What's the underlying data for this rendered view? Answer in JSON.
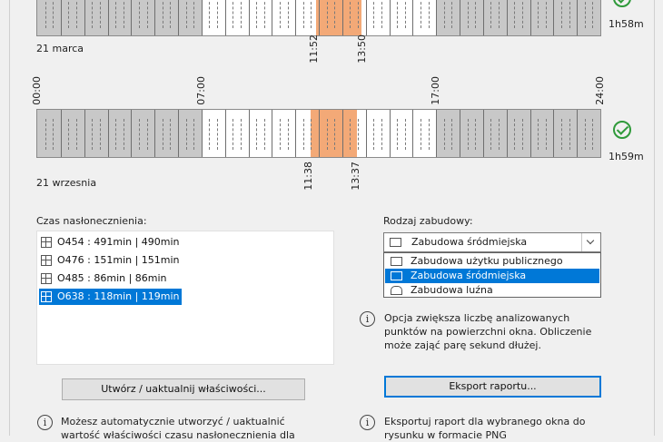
{
  "charts": [
    {
      "date_label": "21 marca",
      "sun_start": "11:52",
      "sun_end": "13:50",
      "duration": "1h58m",
      "status": "ok"
    },
    {
      "date_label": "21 wrzesnia",
      "sun_start": "11:38",
      "sun_end": "13:37",
      "duration": "1h59m",
      "status": "ok",
      "hour_labels": [
        "00:00",
        "07:00",
        "17:00",
        "24:00"
      ]
    }
  ],
  "colors": {
    "day_gray": "#c8c8c8",
    "day_white": "#ffffff",
    "sun_highlight": "#f3a977",
    "ok_green": "#2f9a3a",
    "selection": "#0078d7"
  },
  "sunlight": {
    "label": "Czas nasłonecznienia:",
    "items": [
      {
        "text": "O454 : 491min | 490min",
        "selected": false
      },
      {
        "text": "O476 : 151min | 151min",
        "selected": false
      },
      {
        "text": "O485 : 86min | 86min",
        "selected": false
      },
      {
        "text": "O638 : 118min | 119min",
        "selected": true
      }
    ]
  },
  "building": {
    "label": "Rodzaj zabudowy:",
    "selected": "Zabudowa śródmiejska",
    "options": [
      {
        "text": "Zabudowa użytku publicznego",
        "icon": "public-building-icon",
        "selected": false
      },
      {
        "text": "Zabudowa śródmiejska",
        "icon": "downtown-building-icon",
        "selected": true
      },
      {
        "text": "Zabudowa luźna",
        "icon": "loose-building-icon",
        "selected": false
      }
    ]
  },
  "buttons": {
    "create": "Utwórz / uaktualnij właściwości...",
    "export": "Eksport raportu..."
  },
  "info": {
    "option_note": [
      "Opcja zwiększa liczbę analizowanych",
      "punktów na powierzchni okna. Obliczenie",
      "może zająć parę sekund dłużej."
    ],
    "auto_note": [
      "Możesz automatycznie utworzyć / uaktualnić",
      "wartość właściwości czasu nasłonecznienia dla"
    ],
    "export_note": [
      "Eksportuj raport dla wybranego okna do",
      "rysunku w formacie PNG"
    ]
  }
}
